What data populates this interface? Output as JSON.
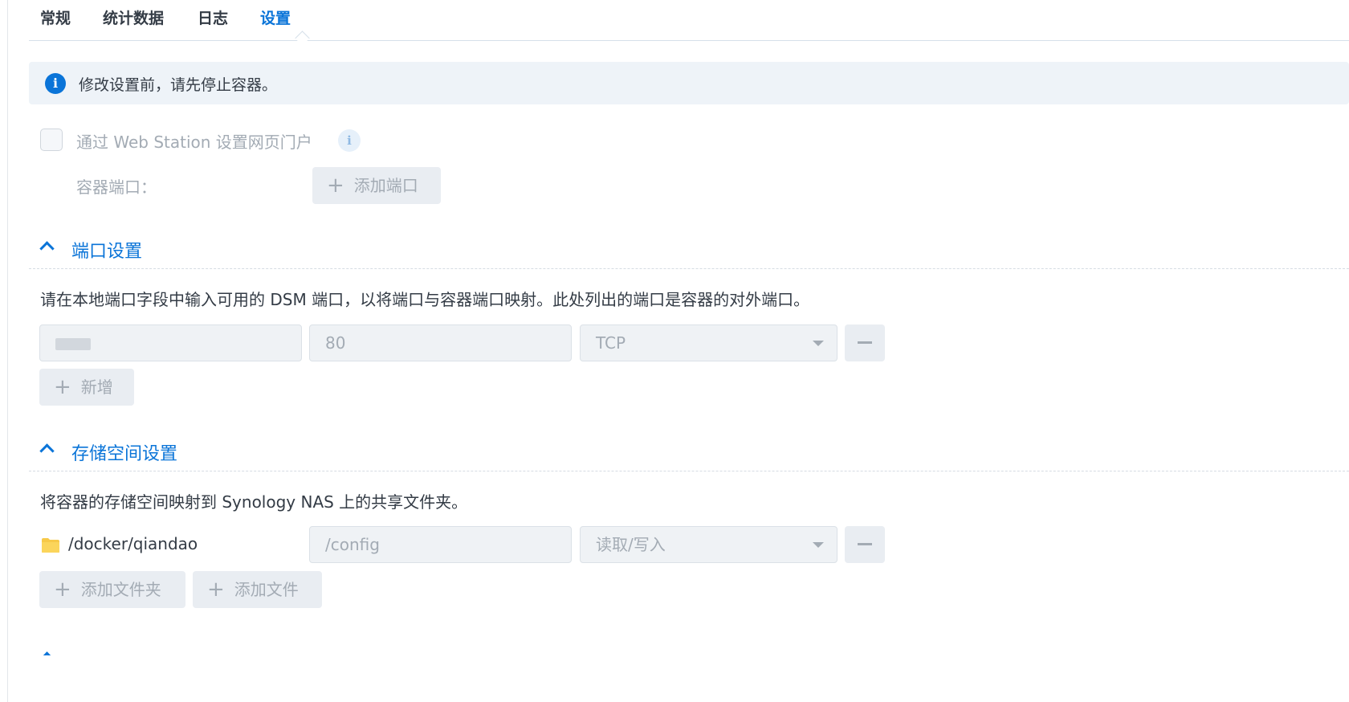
{
  "tabs": [
    {
      "label": "常规",
      "active": false
    },
    {
      "label": "统计数据",
      "active": false
    },
    {
      "label": "日志",
      "active": false
    },
    {
      "label": "设置",
      "active": true
    }
  ],
  "banner": {
    "icon": "info-icon",
    "text": "修改设置前，请先停止容器。"
  },
  "web_station": {
    "checkbox_checked": false,
    "label": "通过 Web Station 设置网页门户",
    "info_icon": "info-icon",
    "container_port_label": "容器端口：",
    "add_port_label": "添加端口"
  },
  "port_settings": {
    "title": "端口设置",
    "description": "请在本地端口字段中输入可用的 DSM 端口，以将端口与容器端口映射。此处列出的端口是容器的对外端口。",
    "rows": [
      {
        "local_port": "",
        "container_port": "80",
        "protocol": "TCP"
      }
    ],
    "add_label": "新增"
  },
  "storage_settings": {
    "title": "存储空间设置",
    "description": "将容器的存储空间映射到 Synology NAS 上的共享文件夹。",
    "rows": [
      {
        "folder": "/docker/qiandao",
        "mount_path": "/config",
        "mode": "读取/写入"
      }
    ],
    "add_folder_label": "添加文件夹",
    "add_file_label": "添加文件"
  },
  "colors": {
    "accent": "#0a74d8",
    "disabled_text": "#a3abb4",
    "banner_bg": "#eef3f8",
    "folder": "#f7c948"
  }
}
